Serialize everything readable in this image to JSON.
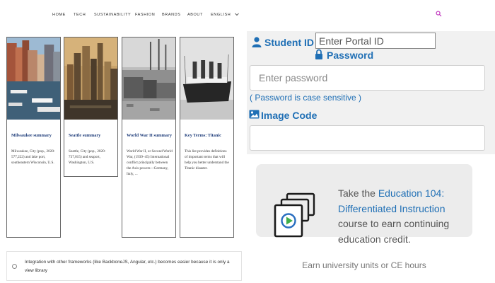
{
  "nav": {
    "items": [
      "HOME",
      "TECH",
      "SUSTAINABILITY",
      "FASHION",
      "BRANDS",
      "ABOUT",
      "ENGLISH"
    ],
    "search_icon": "search-icon",
    "accent": "#c23bbf"
  },
  "cards": [
    {
      "title": "Milwaukee summary",
      "text": "Milwaukee, City (pop., 2020: 577,222) and lake port, southeastern Wisconsin, U.S."
    },
    {
      "title": "Seattle summary",
      "text": "Seattle, City (pop., 2020: 737,015) and seaport, Washington, U.S."
    },
    {
      "title": "World War II summary",
      "text": "World War II, or Second World War, (1939–45) International conflict principally between the Axis powers—Germany, Italy, ..."
    },
    {
      "title": "Key Terms: Titanic",
      "text": "This list provides definitions of important terms that will help you better understand the Titanic disaster."
    }
  ],
  "radio_option": {
    "text": "Integration with other frameworks (like BackboneJS, Angular, etc.) becomes easier because it is only a view library"
  },
  "login": {
    "student_id_label": "Student ID",
    "portal_placeholder": "Enter Portal ID",
    "password_label": "Password",
    "password_placeholder": "Enter password",
    "password_hint": "( Password is case sensitive )",
    "image_code_label": "Image Code",
    "label_color": "#1f6fb5"
  },
  "promo": {
    "text_prefix": "Take the ",
    "course_link": "Education 104: Differentiated Instruction",
    "text_suffix": " course to earn continuing education credit.",
    "subtext": "Earn university units or CE hours",
    "icon": "video-course-icon"
  }
}
